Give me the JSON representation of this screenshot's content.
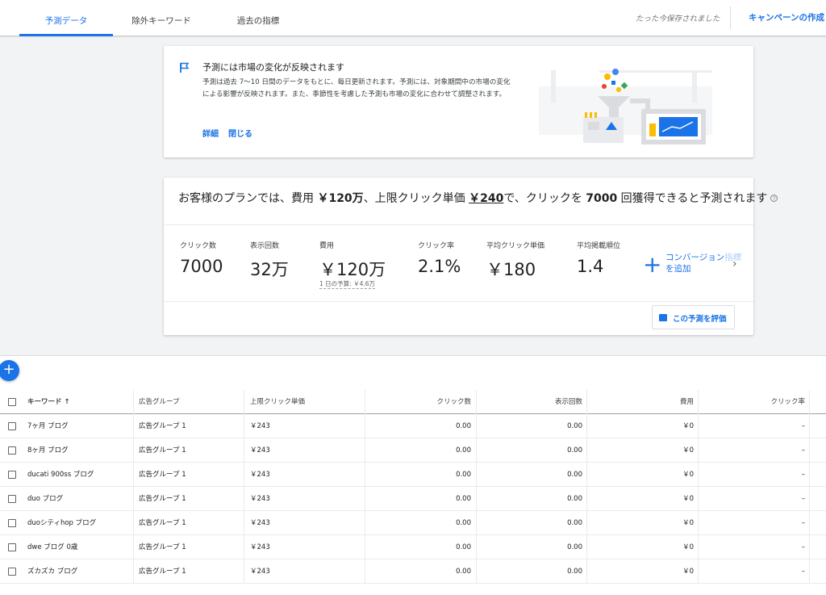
{
  "tabs": [
    {
      "label": "予測データ",
      "active": true
    },
    {
      "label": "除外キーワード",
      "active": false
    },
    {
      "label": "過去の指標",
      "active": false
    }
  ],
  "header": {
    "saved_status": "たった今保存されました",
    "create_campaign": "キャンペーンの作成"
  },
  "info_card": {
    "title": "予測には市場の変化が反映されます",
    "body": "予測は過去 7〜10 日間のデータをもとに、毎日更新されます。予測には、対象期間中の市場の変化による影響が反映されます。また、季節性を考慮した予測も市場の変化に合わせて調整されます。",
    "details_link": "詳細",
    "close_link": "閉じる"
  },
  "plan": {
    "s1": "お客様のプランでは、費用 ",
    "budget": "￥120万",
    "s2": "、上限クリック単価 ",
    "max_cpc": "￥240",
    "s3": "で、クリックを ",
    "clicks": "7000",
    "s4": " 回獲得できると予測されます",
    "metrics": [
      {
        "label": "クリック数",
        "value": "7000"
      },
      {
        "label": "表示回数",
        "value": "32万"
      },
      {
        "label": "費用",
        "value": "￥120万"
      },
      {
        "label": "クリック率",
        "value": "2.1%"
      },
      {
        "label": "平均クリック単価",
        "value": "￥180"
      },
      {
        "label": "平均掲載順位",
        "value": "1.4"
      }
    ],
    "daily_budget": "1 日の予算: ￥4.6万",
    "conversion_line1": "コンバージョン",
    "conversion_line1_fade": "指標",
    "conversion_line2": "を追加",
    "rate_button": "この予測を評価"
  },
  "table": {
    "headers": [
      "キーワード ↑",
      "広告グループ",
      "上限クリック単価",
      "クリック数",
      "表示回数",
      "費用",
      "クリック率"
    ],
    "rows": [
      {
        "keyword": "7ヶ月 ブログ",
        "ad_group": "広告グループ 1",
        "max_cpc": "￥243",
        "clicks": "0.00",
        "impressions": "0.00",
        "cost": "￥0",
        "ctr": "–"
      },
      {
        "keyword": "8ヶ月 ブログ",
        "ad_group": "広告グループ 1",
        "max_cpc": "￥243",
        "clicks": "0.00",
        "impressions": "0.00",
        "cost": "￥0",
        "ctr": "–"
      },
      {
        "keyword": "ducati 900ss ブログ",
        "ad_group": "広告グループ 1",
        "max_cpc": "￥243",
        "clicks": "0.00",
        "impressions": "0.00",
        "cost": "￥0",
        "ctr": "–"
      },
      {
        "keyword": "duo ブログ",
        "ad_group": "広告グループ 1",
        "max_cpc": "￥243",
        "clicks": "0.00",
        "impressions": "0.00",
        "cost": "￥0",
        "ctr": "–"
      },
      {
        "keyword": "duoシティhop ブログ",
        "ad_group": "広告グループ 1",
        "max_cpc": "￥243",
        "clicks": "0.00",
        "impressions": "0.00",
        "cost": "￥0",
        "ctr": "–"
      },
      {
        "keyword": "dwe ブログ 0歳",
        "ad_group": "広告グループ 1",
        "max_cpc": "￥243",
        "clicks": "0.00",
        "impressions": "0.00",
        "cost": "￥0",
        "ctr": "–"
      },
      {
        "keyword": "ズカズカ ブログ",
        "ad_group": "広告グループ 1",
        "max_cpc": "￥243",
        "clicks": "0.00",
        "impressions": "0.00",
        "cost": "￥0",
        "ctr": "–"
      }
    ]
  },
  "colors": {
    "accent": "#1a73e8",
    "background": "#f1f3f4"
  }
}
